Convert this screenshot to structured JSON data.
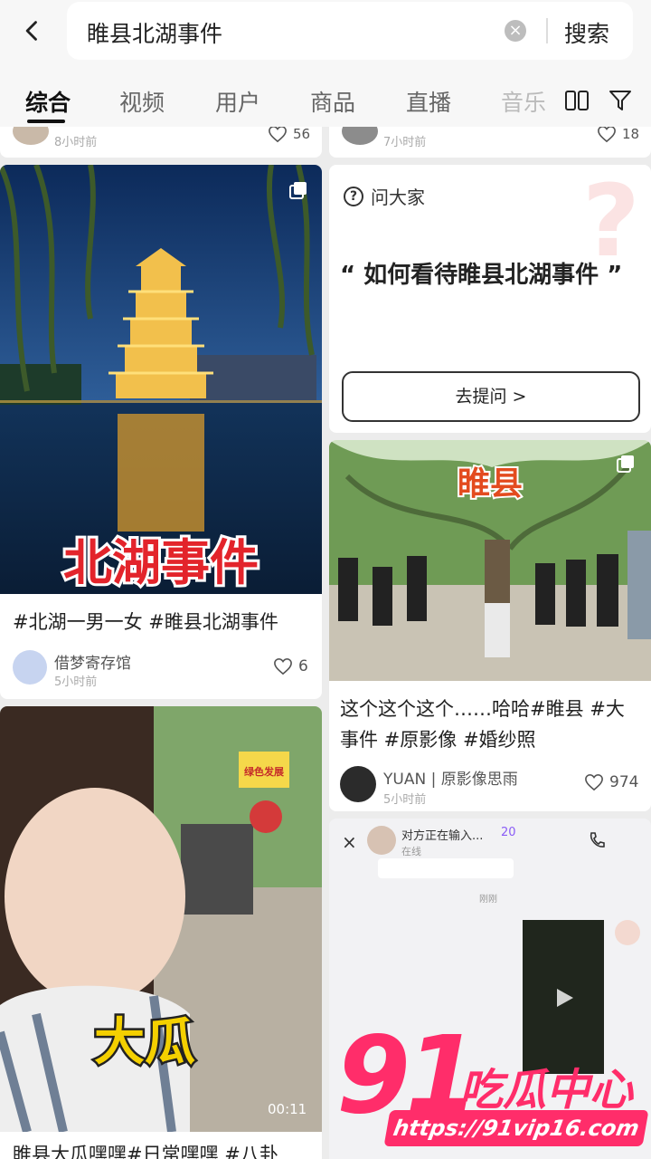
{
  "search": {
    "query": "睢县北湖事件",
    "button": "搜索"
  },
  "tabs": [
    "综合",
    "视频",
    "用户",
    "商品",
    "直播",
    "音乐"
  ],
  "partial_top": {
    "left_time": "8小时前",
    "left_likes": "56",
    "right_time": "7小时前",
    "right_likes": "18"
  },
  "card1": {
    "overlay": "北湖事件",
    "caption": "#北湖一男一女 #睢县北湖事件",
    "author": "借梦寄存馆",
    "time": "5小时前",
    "likes": "6"
  },
  "qa": {
    "head": "问大家",
    "quote": "“ 如何看待睢县北湖事件 ”",
    "button": "去提问 >"
  },
  "card3": {
    "overlay": "睢县",
    "caption": "这个这个这个……哈哈#睢县 #大事件 #原影像 #婚纱照",
    "author": "YUAN | 原影像思雨",
    "time": "5小时前",
    "likes": "974"
  },
  "card4": {
    "overlay": "大瓜",
    "duration": "00:11",
    "sign": "绿色发展",
    "caption": "睢县大瓜嘿嘿#日常嘿嘿 #八卦"
  },
  "chat": {
    "close": "×",
    "name": "对方正在输入...",
    "badge": "20",
    "status": "在线",
    "time": "刚刚"
  },
  "watermark": {
    "logo": "91",
    "text": "吃瓜中心",
    "url": "https://91vip16.com"
  },
  "colors": {
    "accent": "#ff2d6a",
    "text": "#222222"
  }
}
